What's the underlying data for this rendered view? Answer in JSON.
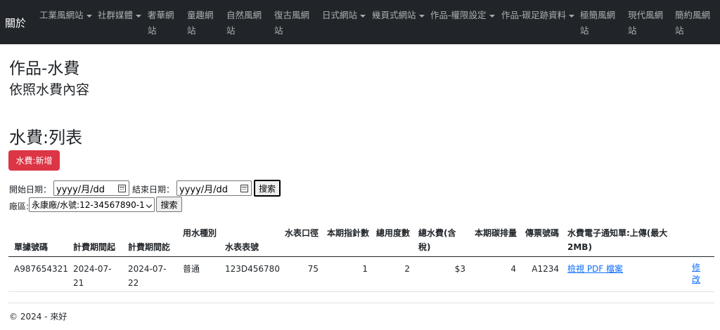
{
  "navbar": {
    "brand": "關於",
    "items": [
      {
        "label": "工業風網站",
        "dropdown": true
      },
      {
        "label": "社群媒體",
        "dropdown": true
      },
      {
        "label": "奢華網站",
        "dropdown": false
      },
      {
        "label": "童趣網站",
        "dropdown": false
      },
      {
        "label": "自然風網站",
        "dropdown": false
      },
      {
        "label": "復古風網站",
        "dropdown": false
      },
      {
        "label": "日式網站",
        "dropdown": true
      },
      {
        "label": "幾頁式網站",
        "dropdown": true
      },
      {
        "label": "作品-權限設定",
        "dropdown": true
      },
      {
        "label": "作品-碳足跡資料",
        "dropdown": true
      },
      {
        "label": "極簡風網站",
        "dropdown": false
      },
      {
        "label": "現代風網站",
        "dropdown": false
      },
      {
        "label": "簡約風網站",
        "dropdown": false
      }
    ]
  },
  "page": {
    "title": "作品-水費",
    "subtitle": "依照水費內容",
    "list_heading": "水費:列表",
    "add_button": "水費:新增"
  },
  "filters": {
    "start_label": "開始日期：",
    "start_value": "yyyy/月/dd",
    "end_label": "結束日期：",
    "end_value": "yyyy/月/dd",
    "search_button": "搜索",
    "plant_label": "廠區:",
    "plant_value": "永康廠/水號:12-34567890-1",
    "search_button_2": "搜索"
  },
  "table": {
    "headers": [
      "單據號碼",
      "計費期間起",
      "計費期間訖",
      "用水種別",
      "水表表號",
      "水表口徑",
      "本期指針數",
      "總用度數",
      "總水費(含稅)",
      "本期碳排量",
      "傳票號碼",
      "水費電子通知單:上傳(最大2MB)"
    ],
    "rows": [
      {
        "doc_no": "A987654321",
        "period_start": "2024-07-21",
        "period_end": "2024-07-22",
        "water_type": "普通",
        "meter_no": "123D456780",
        "caliber": "75",
        "reading": "1",
        "usage": "2",
        "fee": "$3",
        "carbon": "4",
        "voucher": "A1234",
        "pdf_link": "檢視 PDF 檔案",
        "edit_link": "修改"
      }
    ]
  },
  "footer": "© 2024 - 來好"
}
